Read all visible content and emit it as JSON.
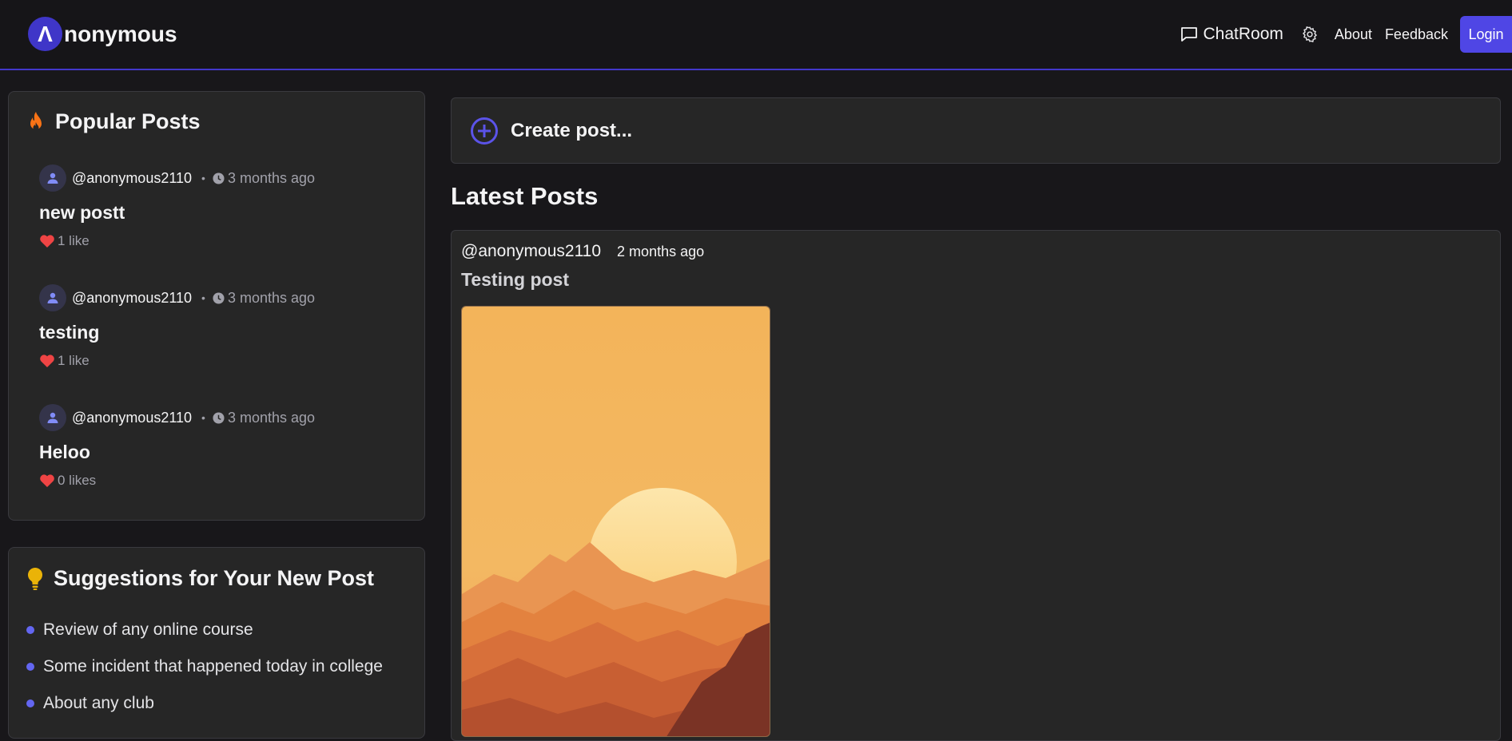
{
  "brand": {
    "logo_letter": "Λ",
    "name": "nonymous",
    "accent": "#4f46e5"
  },
  "nav": {
    "chatroom": "ChatRoom",
    "settings_icon": "gear-icon",
    "about": "About",
    "feedback": "Feedback",
    "login": "Login"
  },
  "popular": {
    "title": "Popular Posts",
    "icon": "fire-icon",
    "posts": [
      {
        "user": "@anonymous2110",
        "time": "3 months ago",
        "title": "new postt",
        "likes": "1 like"
      },
      {
        "user": "@anonymous2110",
        "time": "3 months ago",
        "title": "testing",
        "likes": "1 like"
      },
      {
        "user": "@anonymous2110",
        "time": "3 months ago",
        "title": "Heloo",
        "likes": "0 likes"
      }
    ]
  },
  "suggestions": {
    "title": "Suggestions for Your New Post",
    "icon": "lightbulb-icon",
    "items": [
      "Review of any online course",
      "Some incident that happened today in college",
      "About any club"
    ]
  },
  "create_post": {
    "label": "Create post..."
  },
  "latest": {
    "heading": "Latest Posts",
    "posts": [
      {
        "user": "@anonymous2110",
        "time": "2 months ago",
        "title": "Testing post",
        "image": "sunset-mountains-illustration"
      }
    ]
  },
  "colors": {
    "background": "#18171a",
    "card": "#262626",
    "heart": "#ef4444",
    "fire": "#f97316",
    "bulb": "#eab308"
  }
}
